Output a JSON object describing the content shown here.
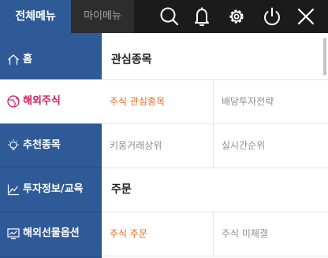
{
  "tabs": {
    "all_menu": "전체메뉴",
    "my_menu": "마이메뉴"
  },
  "toolbar_icons": [
    "search-icon",
    "bell-icon",
    "gear-icon",
    "power-icon",
    "close-icon"
  ],
  "sidebar": {
    "items": [
      {
        "label": "홈",
        "icon": "home-icon"
      },
      {
        "label": "해외주식",
        "icon": "globe-icon",
        "active": true
      },
      {
        "label": "추천종목",
        "icon": "lightbulb-icon"
      },
      {
        "label": "투자정보/교육",
        "icon": "chart-icon"
      },
      {
        "label": "해외선물옵션",
        "icon": "monitor-chart-icon"
      }
    ]
  },
  "content": {
    "sections": [
      {
        "title": "관심종목"
      },
      {
        "items": [
          "주식 관심종목",
          "배당투자전략"
        ]
      },
      {
        "items": [
          "키움거래상위",
          "실시간순위"
        ]
      },
      {
        "title": "주문"
      },
      {
        "items": [
          "주식 주문",
          "주식 미체결"
        ]
      }
    ]
  },
  "colors": {
    "sidebar_bg": "#2f5a98",
    "topbar_bg": "#1b1b1b",
    "active_text": "#d2195f",
    "highlight_item": "#f0661e"
  }
}
